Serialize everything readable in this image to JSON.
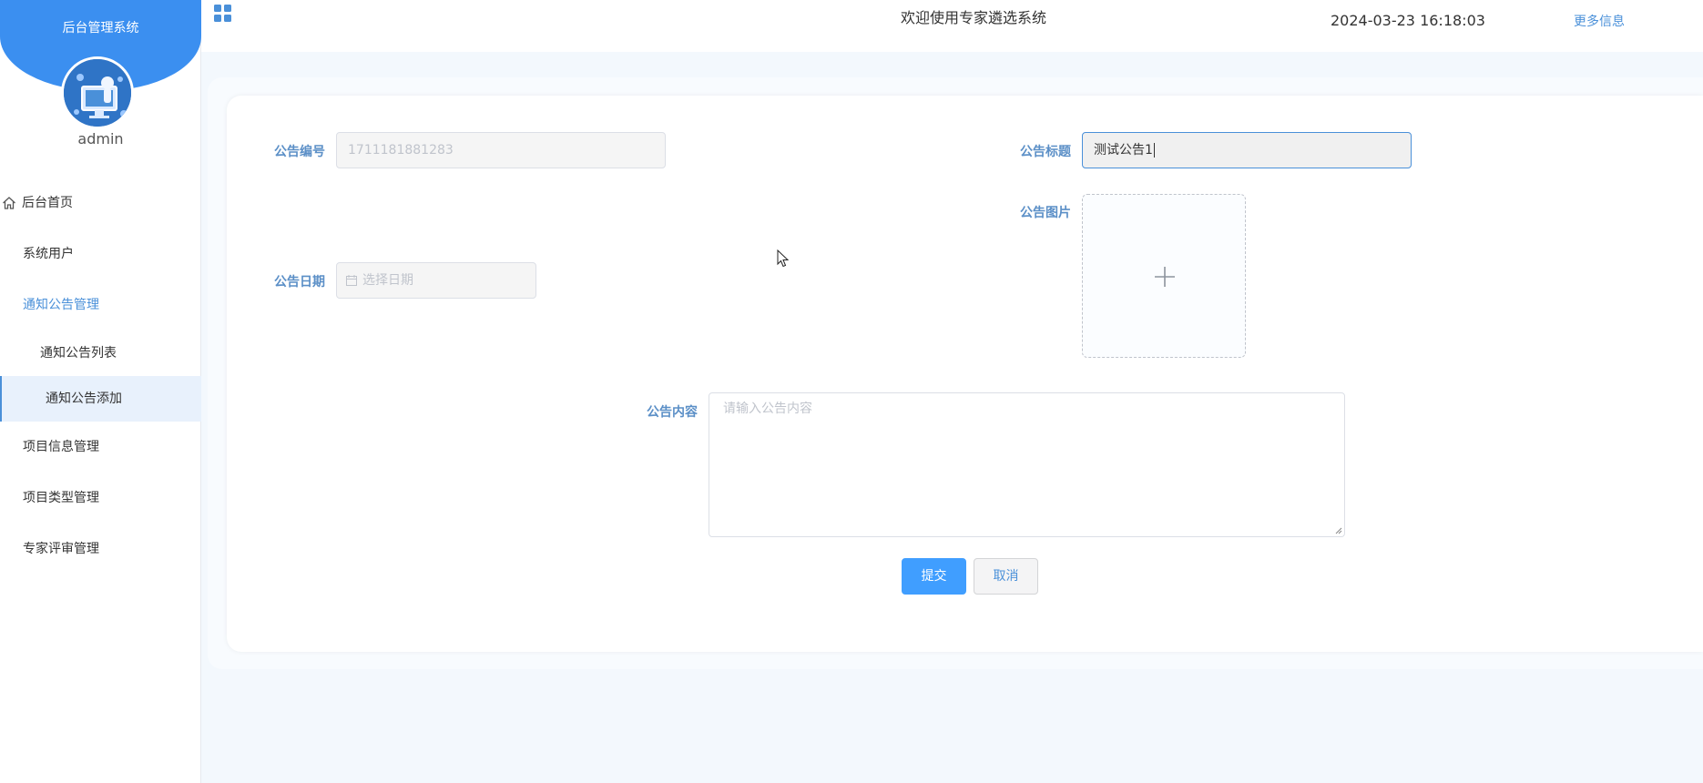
{
  "sidebar": {
    "brand_title": "后台管理系统",
    "username": "admin",
    "menu": [
      {
        "label": "后台首页",
        "icon": "home-icon"
      },
      {
        "label": "系统用户"
      },
      {
        "label": "通知公告管理",
        "expanded": true
      },
      {
        "label": "项目信息管理"
      },
      {
        "label": "项目类型管理"
      },
      {
        "label": "专家评审管理"
      }
    ],
    "submenu": [
      {
        "label": "通知公告列表"
      },
      {
        "label": "通知公告添加",
        "active": true
      }
    ]
  },
  "header": {
    "welcome": "欢迎使用专家遴选系统",
    "datetime": "2024-03-23 16:18:03",
    "more_info": "更多信息"
  },
  "form": {
    "number_label": "公告编号",
    "number_value": "1711181881283",
    "title_label": "公告标题",
    "title_value": "测试公告1",
    "image_label": "公告图片",
    "date_label": "公告日期",
    "date_placeholder": "选择日期",
    "content_label": "公告内容",
    "content_placeholder": "请输入公告内容",
    "submit_label": "提交",
    "cancel_label": "取消"
  },
  "colors": {
    "accent": "#409eff",
    "brand": "#3b8ff0",
    "label": "#5b8fc7",
    "active_bg": "#e8f1fc"
  }
}
